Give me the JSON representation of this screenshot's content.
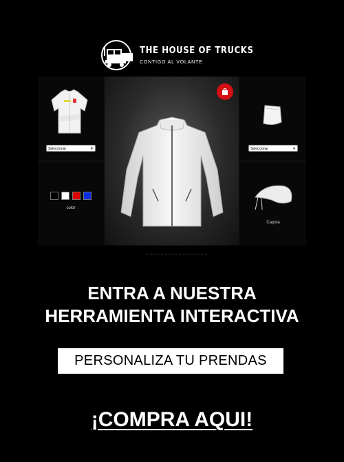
{
  "brand": {
    "name": "THE HOUSE OF TRUCKS",
    "tagline": "CONTIGO AL VOLANTE"
  },
  "configurator": {
    "left_select": "Seleccionar",
    "right_select": "Seleccionar",
    "color_label": "color",
    "swatches": [
      "#000000",
      "#ffffff",
      "#e00000",
      "#0a2ee0"
    ],
    "hood_label": "Capota",
    "accent": "#d40f14"
  },
  "headline": {
    "line1": "ENTRA A NUESTRA",
    "line2": "HERRAMIENTA INTERACTIVA"
  },
  "subheadline": "PERSONALIZA TU PRENDAS",
  "cta": "¡COMPRA AQUI!"
}
